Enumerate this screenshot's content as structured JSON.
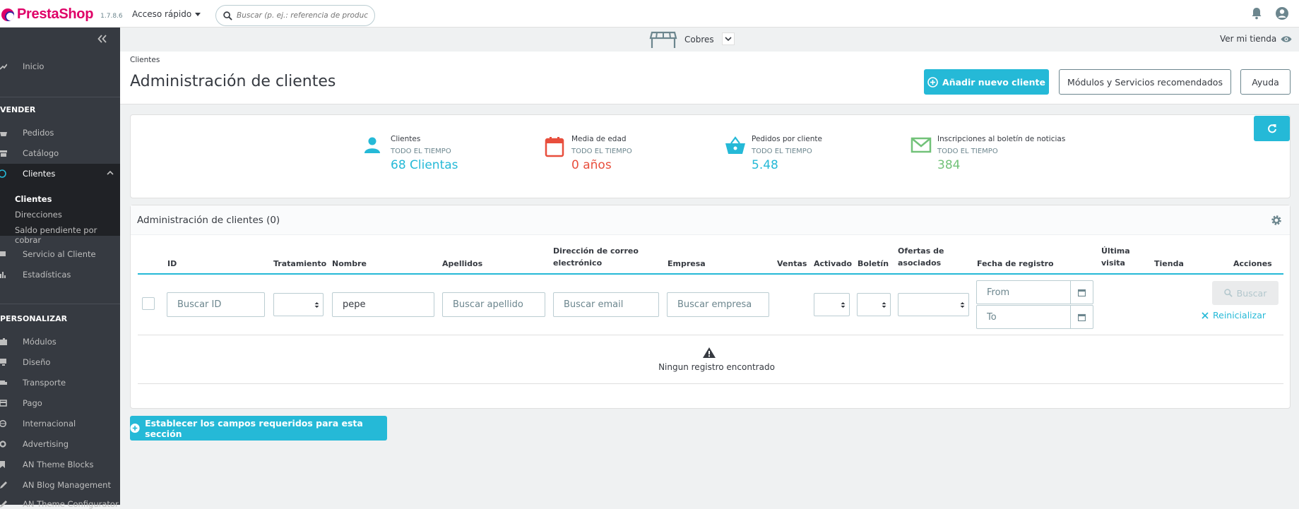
{
  "app": {
    "brand": "PrestaShop",
    "version": "1.7.8.6",
    "quick_access": "Acceso rápido",
    "search_placeholder": "Buscar (p. ej.: referencia de producto,"
  },
  "sidebar": {
    "home": "Inicio",
    "section_sell": "VENDER",
    "orders": "Pedidos",
    "catalog": "Catálogo",
    "customers": "Clientes",
    "sub_customers": "Clientes",
    "sub_addresses": "Direcciones",
    "sub_outstanding": "Saldo pendiente por cobrar",
    "customer_service": "Servicio al Cliente",
    "stats": "Estadísticas",
    "section_customize": "PERSONALIZAR",
    "modules": "Módulos",
    "design": "Diseño",
    "shipping": "Transporte",
    "payment": "Pago",
    "international": "Internacional",
    "advertising": "Advertising",
    "an_theme_blocks": "AN Theme Blocks",
    "an_blog": "AN Blog Management",
    "an_theme_config": "AN Theme Configurator"
  },
  "shopbar": {
    "shop_name": "Cobres",
    "view_shop": "Ver mi tienda"
  },
  "header": {
    "breadcrumb": "Clientes",
    "title": "Administración de clientes",
    "btn_add": "Añadir nuevo cliente",
    "btn_modules": "Módulos y Servicios recomendados",
    "btn_help": "Ayuda"
  },
  "kpis": [
    {
      "title": "Clientes",
      "period": "TODO EL TIEMPO",
      "value": "68 Clientas",
      "color": "#25b9d7"
    },
    {
      "title": "Media de edad",
      "period": "TODO EL TIEMPO",
      "value": "0 años",
      "color": "#e84e3c"
    },
    {
      "title": "Pedidos por cliente",
      "period": "TODO EL TIEMPO",
      "value": "5.48",
      "color": "#25b9d7"
    },
    {
      "title": "Inscripciones al boletín de noticias",
      "period": "TODO EL TIEMPO",
      "value": "384",
      "color": "#72c279"
    }
  ],
  "panel": {
    "title": "Administración de clientes (0)",
    "columns": {
      "id": "ID",
      "title": "Tratamiento",
      "firstname": "Nombre",
      "lastname": "Apellidos",
      "email_1": "Dirección de correo",
      "email_2": "electrónico",
      "company": "Empresa",
      "sales": "Ventas",
      "active": "Activado",
      "newsletter": "Boletín",
      "optin_1": "Ofertas de",
      "optin_2": "asociados",
      "date_add": "Fecha de registro",
      "last_visit_1": "Última",
      "last_visit_2": "visita",
      "shop": "Tienda",
      "actions": "Acciones"
    },
    "filters": {
      "id_placeholder": "Buscar ID",
      "firstname_value": "pepe",
      "lastname_placeholder": "Buscar apellido",
      "email_placeholder": "Buscar email",
      "company_placeholder": "Buscar empresa",
      "date_from_placeholder": "From",
      "date_to_placeholder": "To",
      "search_btn": "Buscar",
      "reset_btn": "Reinicializar"
    },
    "empty": "Ningun registro encontrado"
  },
  "footer_btn": "Establecer los campos requeridos para esta sección",
  "colors": {
    "accent": "#25b9d7",
    "sidebar": "#363a41",
    "brand": "#df0067"
  }
}
